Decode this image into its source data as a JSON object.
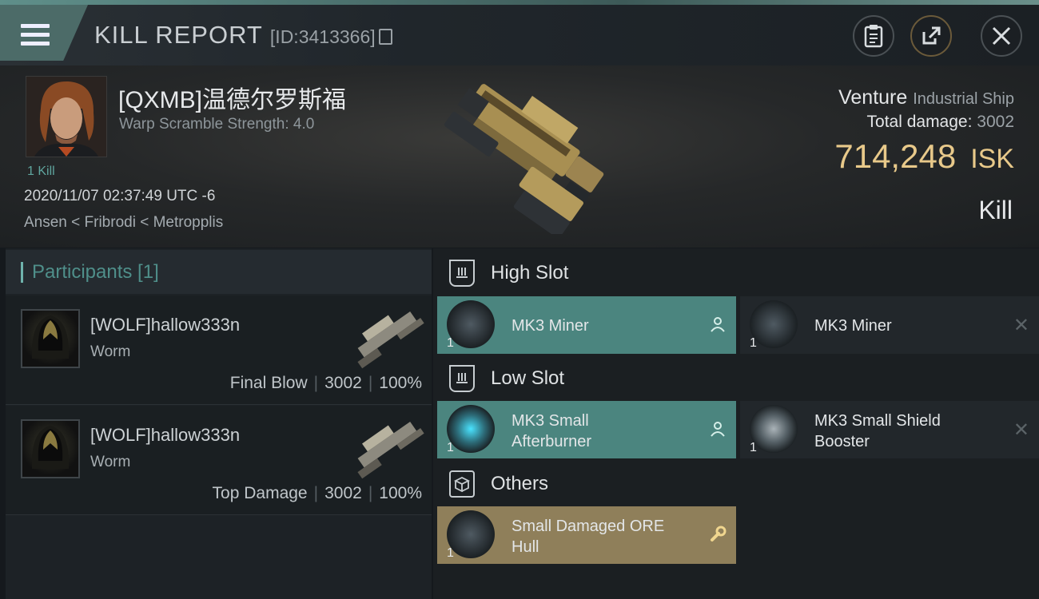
{
  "header": {
    "title": "KILL REPORT",
    "id_text": "[ID:3413366]",
    "icons": [
      "menu-icon",
      "copy-icon",
      "clipboard-icon",
      "share-icon",
      "close-icon"
    ]
  },
  "victim": {
    "name": "[QXMB]温德尔罗斯福",
    "warp_scramble": "Warp Scramble Strength: 4.0",
    "kills": "1 Kill",
    "datetime": "2020/11/07 02:37:49 UTC -6",
    "location": "Ansen < Fribrodi < Metropplis",
    "ship_name": "Venture",
    "ship_class": "Industrial Ship",
    "total_damage_label": "Total damage:",
    "total_damage": "3002",
    "isk_value": "714,248",
    "isk_unit": "ISK",
    "result": "Kill"
  },
  "participants": {
    "heading": "Participants [1]",
    "rows": [
      {
        "name": "[WOLF]hallow333n",
        "ship": "Worm",
        "role": "Final Blow",
        "damage": "3002",
        "percent": "100%"
      },
      {
        "name": "[WOLF]hallow333n",
        "ship": "Worm",
        "role": "Top Damage",
        "damage": "3002",
        "percent": "100%"
      }
    ]
  },
  "fitting": {
    "high_slot": {
      "label": "High Slot",
      "items": [
        {
          "name": "MK3 Miner",
          "qty": "1",
          "state": "dropped"
        },
        {
          "name": "MK3 Miner",
          "qty": "1",
          "state": "destroyed"
        }
      ]
    },
    "low_slot": {
      "label": "Low Slot",
      "items": [
        {
          "name": "MK3 Small Afterburner",
          "qty": "1",
          "state": "dropped"
        },
        {
          "name": "MK3 Small Shield Booster",
          "qty": "1",
          "state": "destroyed"
        }
      ]
    },
    "others": {
      "label": "Others",
      "items": [
        {
          "name": "Small Damaged ORE Hull",
          "qty": "1",
          "state": "salvage"
        }
      ]
    }
  },
  "colors": {
    "accent_teal": "#4b857f",
    "isk_gold": "#e8c98a",
    "salvage_gold": "#8f7f5a"
  }
}
